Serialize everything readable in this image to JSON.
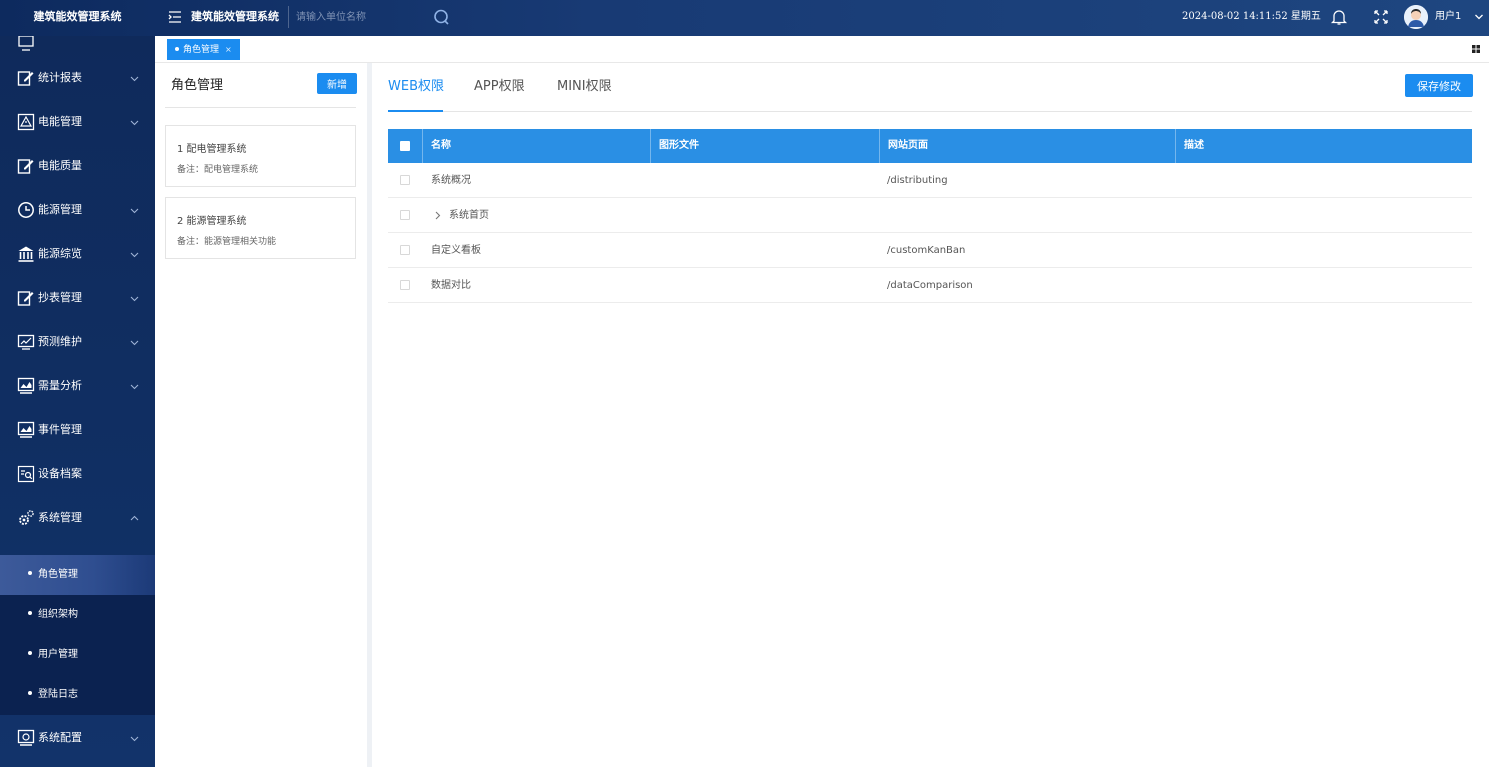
{
  "topbar": {
    "app_name": "建筑能效管理系统",
    "system_title": "建筑能效管理系统",
    "unit_search_placeholder": "请输入单位名称",
    "datetime": "2024-08-02 14:11:52 星期五",
    "username": "用户1"
  },
  "sidebar": {
    "items": [
      {
        "label": "统计报表",
        "icon": "report-edit-icon",
        "has_caret": true
      },
      {
        "label": "电能管理",
        "icon": "warning-triangle-icon",
        "has_caret": true
      },
      {
        "label": "电能质量",
        "icon": "report-edit-icon",
        "has_caret": false
      },
      {
        "label": "能源管理",
        "icon": "clock-icon",
        "has_caret": true
      },
      {
        "label": "能源综览",
        "icon": "bank-icon",
        "has_caret": true
      },
      {
        "label": "抄表管理",
        "icon": "report-edit-icon",
        "has_caret": true
      },
      {
        "label": "预测维护",
        "icon": "trend-chart-icon",
        "has_caret": true
      },
      {
        "label": "需量分析",
        "icon": "monitor-chart-icon",
        "has_caret": true
      },
      {
        "label": "事件管理",
        "icon": "monitor-chart-icon",
        "has_caret": false
      },
      {
        "label": "设备档案",
        "icon": "device-search-icon",
        "has_caret": false
      },
      {
        "label": "系统管理",
        "icon": "gears-icon",
        "has_caret": true,
        "expanded": true
      },
      {
        "label": "系统配置",
        "icon": "monitor-config-icon",
        "has_caret": true
      }
    ],
    "system_submenu": [
      {
        "label": "角色管理",
        "active": true
      },
      {
        "label": "组织架构",
        "active": false
      },
      {
        "label": "用户管理",
        "active": false
      },
      {
        "label": "登陆日志",
        "active": false
      }
    ]
  },
  "tabs": {
    "open_tabs": [
      {
        "label": "角色管理",
        "close": "×"
      }
    ]
  },
  "role_panel": {
    "title": "角色管理",
    "add_label": "新增",
    "roles": [
      {
        "name": "1 配电管理系统",
        "note": "备注：配电管理系统"
      },
      {
        "name": "2 能源管理系统",
        "note": "备注：能源管理相关功能"
      }
    ]
  },
  "permissions": {
    "tabs": [
      "WEB权限",
      "APP权限",
      "MINI权限"
    ],
    "active_tab": "WEB权限",
    "save_label": "保存修改",
    "columns": [
      "名称",
      "图形文件",
      "网站页面",
      "描述"
    ],
    "rows": [
      {
        "name": "系统概况",
        "graphic": "",
        "page": "/distributing",
        "desc": "",
        "expandable": false
      },
      {
        "name": "系统首页",
        "graphic": "",
        "page": "",
        "desc": "",
        "expandable": true
      },
      {
        "name": "自定义看板",
        "graphic": "",
        "page": "/customKanBan",
        "desc": "",
        "expandable": false
      },
      {
        "name": "数据对比",
        "graphic": "",
        "page": "/dataComparison",
        "desc": "",
        "expandable": false
      }
    ]
  },
  "colors": {
    "accent": "#1b8cf0",
    "table_header": "#2a8fe4",
    "sidebar_bg": "#0f2a5b",
    "topbar_bg": "#0d2a5e"
  }
}
